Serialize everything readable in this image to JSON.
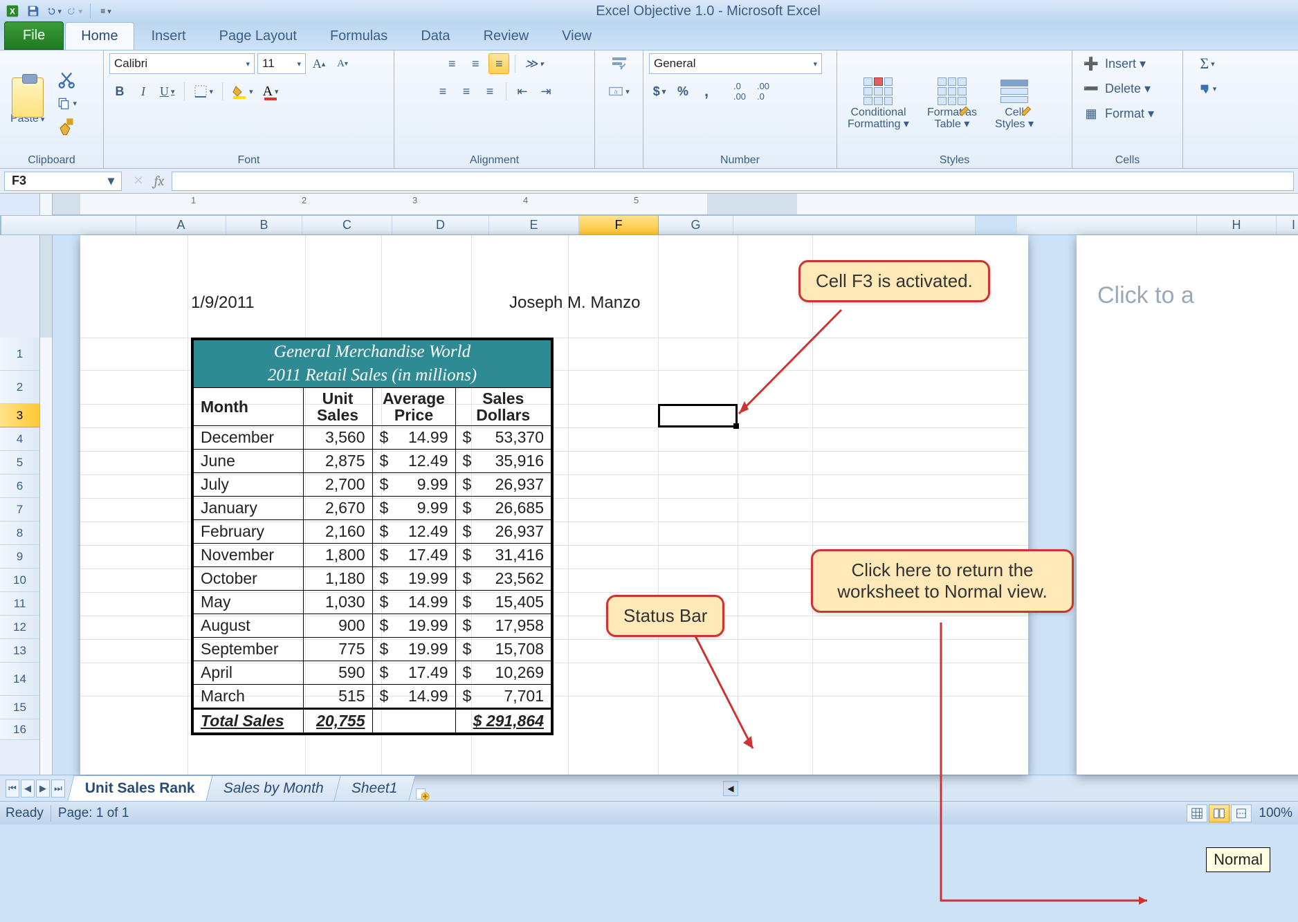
{
  "app_title": "Excel Objective 1.0 - Microsoft Excel",
  "tabs": {
    "file": "File",
    "home": "Home",
    "insert": "Insert",
    "pagelayout": "Page Layout",
    "formulas": "Formulas",
    "data": "Data",
    "review": "Review",
    "view": "View"
  },
  "ribbon": {
    "clipboard": {
      "paste": "Paste",
      "label": "Clipboard"
    },
    "font": {
      "name": "Calibri",
      "size": "11",
      "bold": "B",
      "italic": "I",
      "underline": "U",
      "label": "Font"
    },
    "alignment": {
      "label": "Alignment"
    },
    "number": {
      "format": "General",
      "label": "Number"
    },
    "styles": {
      "cond": "Conditional\nFormatting ▾",
      "fmtas": "Format as\nTable ▾",
      "cell": "Cell\nStyles ▾",
      "label": "Styles"
    },
    "cells": {
      "insert": "Insert ▾",
      "delete": "Delete ▾",
      "format": "Format ▾",
      "label": "Cells"
    }
  },
  "namebox": "F3",
  "columns": [
    "A",
    "B",
    "C",
    "D",
    "E",
    "F",
    "G",
    "H",
    "I"
  ],
  "rows": [
    "1",
    "2",
    "3",
    "4",
    "5",
    "6",
    "7",
    "8",
    "9",
    "10",
    "11",
    "12",
    "13",
    "14",
    "15",
    "16"
  ],
  "doc": {
    "date": "1/9/2011",
    "author": "Joseph M. Manzo",
    "title1": "General Merchandise World",
    "title2": "2011 Retail Sales (in millions)",
    "headers": {
      "month": "Month",
      "units": "Unit Sales",
      "avg": "Average Price",
      "dollars": "Sales Dollars"
    },
    "rows": [
      {
        "m": "December",
        "u": "3,560",
        "p": "14.99",
        "d": "53,370"
      },
      {
        "m": "June",
        "u": "2,875",
        "p": "12.49",
        "d": "35,916"
      },
      {
        "m": "July",
        "u": "2,700",
        "p": "9.99",
        "d": "26,937"
      },
      {
        "m": "January",
        "u": "2,670",
        "p": "9.99",
        "d": "26,685"
      },
      {
        "m": "February",
        "u": "2,160",
        "p": "12.49",
        "d": "26,937"
      },
      {
        "m": "November",
        "u": "1,800",
        "p": "17.49",
        "d": "31,416"
      },
      {
        "m": "October",
        "u": "1,180",
        "p": "19.99",
        "d": "23,562"
      },
      {
        "m": "May",
        "u": "1,030",
        "p": "14.99",
        "d": "15,405"
      },
      {
        "m": "August",
        "u": "900",
        "p": "19.99",
        "d": "17,958"
      },
      {
        "m": "September",
        "u": "775",
        "p": "19.99",
        "d": "15,708"
      },
      {
        "m": "April",
        "u": "590",
        "p": "17.49",
        "d": "10,269"
      },
      {
        "m": "March",
        "u": "515",
        "p": "14.99",
        "d": "7,701"
      }
    ],
    "total": {
      "label": "Total Sales",
      "units": "20,755",
      "dollars": "$   291,864"
    }
  },
  "page2_header_hint": "Click to a",
  "callouts": {
    "f3": "Cell F3 is activated.",
    "normal": "Click here to return the worksheet to Normal view.",
    "status": "Status Bar"
  },
  "tooltip": "Normal",
  "sheets": [
    "Unit Sales Rank",
    "Sales by Month",
    "Sheet1"
  ],
  "status": {
    "ready": "Ready",
    "page": "Page: 1 of 1",
    "zoom": "100%"
  }
}
